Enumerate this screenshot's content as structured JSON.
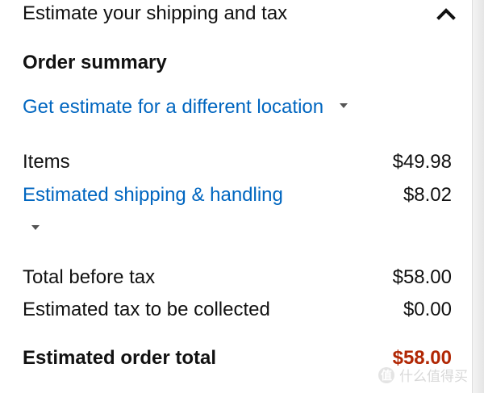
{
  "header": {
    "title": "Estimate your shipping and tax",
    "collapse_icon": "chevron-up-icon"
  },
  "summary": {
    "title": "Order summary",
    "location_link": "Get estimate for a different location"
  },
  "rows": {
    "items": {
      "label": "Items",
      "value": "$49.98"
    },
    "shipping": {
      "label": "Estimated shipping & handling",
      "value": "$8.02"
    },
    "before_tax": {
      "label": "Total before tax",
      "value": "$58.00"
    },
    "tax": {
      "label": "Estimated tax to be collected",
      "value": "$0.00"
    },
    "total": {
      "label": "Estimated order total",
      "value": "$58.00"
    }
  },
  "watermark": {
    "icon": "值",
    "text": "什么值得买"
  },
  "colors": {
    "link": "#0066c0",
    "total": "#b12704",
    "text": "#111111"
  }
}
